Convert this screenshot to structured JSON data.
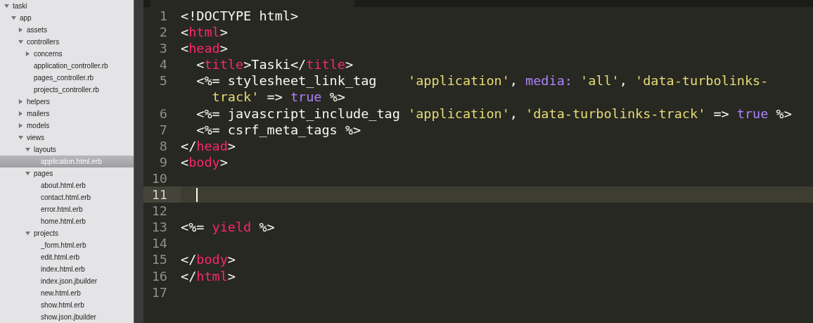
{
  "sidebar": {
    "tree": [
      {
        "label": "taski",
        "kind": "folder",
        "expanded": true,
        "selected": false,
        "children": [
          {
            "label": "app",
            "kind": "folder",
            "expanded": true,
            "selected": false,
            "children": [
              {
                "label": "assets",
                "kind": "folder",
                "expanded": false,
                "selected": false
              },
              {
                "label": "controllers",
                "kind": "folder",
                "expanded": true,
                "selected": false,
                "children": [
                  {
                    "label": "concerns",
                    "kind": "folder",
                    "expanded": false,
                    "selected": false
                  },
                  {
                    "label": "application_controller.rb",
                    "kind": "file",
                    "selected": false
                  },
                  {
                    "label": "pages_controller.rb",
                    "kind": "file",
                    "selected": false
                  },
                  {
                    "label": "projects_controller.rb",
                    "kind": "file",
                    "selected": false
                  }
                ]
              },
              {
                "label": "helpers",
                "kind": "folder",
                "expanded": false,
                "selected": false
              },
              {
                "label": "mailers",
                "kind": "folder",
                "expanded": false,
                "selected": false
              },
              {
                "label": "models",
                "kind": "folder",
                "expanded": false,
                "selected": false
              },
              {
                "label": "views",
                "kind": "folder",
                "expanded": true,
                "selected": false,
                "children": [
                  {
                    "label": "layouts",
                    "kind": "folder",
                    "expanded": true,
                    "selected": false,
                    "children": [
                      {
                        "label": "application.html.erb",
                        "kind": "file",
                        "selected": true
                      }
                    ]
                  },
                  {
                    "label": "pages",
                    "kind": "folder",
                    "expanded": true,
                    "selected": false,
                    "children": [
                      {
                        "label": "about.html.erb",
                        "kind": "file",
                        "selected": false
                      },
                      {
                        "label": "contact.html.erb",
                        "kind": "file",
                        "selected": false
                      },
                      {
                        "label": "error.html.erb",
                        "kind": "file",
                        "selected": false
                      },
                      {
                        "label": "home.html.erb",
                        "kind": "file",
                        "selected": false
                      }
                    ]
                  },
                  {
                    "label": "projects",
                    "kind": "folder",
                    "expanded": true,
                    "selected": false,
                    "children": [
                      {
                        "label": "_form.html.erb",
                        "kind": "file",
                        "selected": false
                      },
                      {
                        "label": "edit.html.erb",
                        "kind": "file",
                        "selected": false
                      },
                      {
                        "label": "index.html.erb",
                        "kind": "file",
                        "selected": false
                      },
                      {
                        "label": "index.json.jbuilder",
                        "kind": "file",
                        "selected": false
                      },
                      {
                        "label": "new.html.erb",
                        "kind": "file",
                        "selected": false
                      },
                      {
                        "label": "show.html.erb",
                        "kind": "file",
                        "selected": false
                      },
                      {
                        "label": "show.json.jbuilder",
                        "kind": "file",
                        "selected": false
                      }
                    ]
                  }
                ]
              }
            ]
          }
        ]
      }
    ]
  },
  "editor": {
    "lines": [
      {
        "number": "1",
        "current": false,
        "rows": [
          [
            {
              "kind": "plain",
              "text": "<!DOCTYPE html>"
            }
          ]
        ]
      },
      {
        "number": "2",
        "current": false,
        "rows": [
          [
            {
              "kind": "plain",
              "text": "<"
            },
            {
              "kind": "tag",
              "text": "html"
            },
            {
              "kind": "plain",
              "text": ">"
            }
          ]
        ]
      },
      {
        "number": "3",
        "current": false,
        "rows": [
          [
            {
              "kind": "plain",
              "text": "<"
            },
            {
              "kind": "tag",
              "text": "head"
            },
            {
              "kind": "plain",
              "text": ">"
            }
          ]
        ]
      },
      {
        "number": "4",
        "current": false,
        "rows": [
          [
            {
              "kind": "plain",
              "text": "  <"
            },
            {
              "kind": "tag",
              "text": "title"
            },
            {
              "kind": "plain",
              "text": ">Taski</"
            },
            {
              "kind": "tag",
              "text": "title"
            },
            {
              "kind": "plain",
              "text": ">"
            }
          ]
        ]
      },
      {
        "number": "5",
        "current": false,
        "rows": [
          [
            {
              "kind": "plain",
              "text": "  <%= stylesheet_link_tag    "
            },
            {
              "kind": "string",
              "text": "'application'"
            },
            {
              "kind": "plain",
              "text": ", "
            },
            {
              "kind": "keyword",
              "text": "media:"
            },
            {
              "kind": "plain",
              "text": " "
            },
            {
              "kind": "string",
              "text": "'all'"
            },
            {
              "kind": "plain",
              "text": ", "
            },
            {
              "kind": "string",
              "text": "'data-turbolinks-"
            },
            {
              "kind": "string",
              "text": "    track'",
              "wrapped": true
            },
            {
              "kind": "plain",
              "text": " => "
            },
            {
              "kind": "keyword",
              "text": "true"
            },
            {
              "kind": "plain",
              "text": " %>"
            }
          ]
        ]
      },
      {
        "number": "6",
        "current": false,
        "rows": [
          [
            {
              "kind": "plain",
              "text": "  <%= javascript_include_tag "
            },
            {
              "kind": "string",
              "text": "'application'"
            },
            {
              "kind": "plain",
              "text": ", "
            },
            {
              "kind": "string",
              "text": "'data-turbolinks-track'"
            },
            {
              "kind": "plain",
              "text": " => "
            },
            {
              "kind": "keyword",
              "text": "true"
            },
            {
              "kind": "plain",
              "text": " %>"
            }
          ]
        ]
      },
      {
        "number": "7",
        "current": false,
        "rows": [
          [
            {
              "kind": "plain",
              "text": "  <%= csrf_meta_tags %>"
            }
          ]
        ]
      },
      {
        "number": "8",
        "current": false,
        "rows": [
          [
            {
              "kind": "plain",
              "text": "</"
            },
            {
              "kind": "tag",
              "text": "head"
            },
            {
              "kind": "plain",
              "text": ">"
            }
          ]
        ]
      },
      {
        "number": "9",
        "current": false,
        "rows": [
          [
            {
              "kind": "plain",
              "text": "<"
            },
            {
              "kind": "tag",
              "text": "body"
            },
            {
              "kind": "plain",
              "text": ">"
            }
          ]
        ]
      },
      {
        "number": "10",
        "current": false,
        "rows": [
          []
        ]
      },
      {
        "number": "11",
        "current": true,
        "rows": [
          []
        ]
      },
      {
        "number": "12",
        "current": false,
        "rows": [
          []
        ]
      },
      {
        "number": "13",
        "current": false,
        "rows": [
          [
            {
              "kind": "plain",
              "text": "<%= "
            },
            {
              "kind": "tag",
              "text": "yield"
            },
            {
              "kind": "plain",
              "text": " %>"
            }
          ]
        ]
      },
      {
        "number": "14",
        "current": false,
        "rows": [
          []
        ]
      },
      {
        "number": "15",
        "current": false,
        "rows": [
          [
            {
              "kind": "plain",
              "text": "</"
            },
            {
              "kind": "tag",
              "text": "body"
            },
            {
              "kind": "plain",
              "text": ">"
            }
          ]
        ]
      },
      {
        "number": "16",
        "current": false,
        "rows": [
          [
            {
              "kind": "plain",
              "text": "</"
            },
            {
              "kind": "tag",
              "text": "html"
            },
            {
              "kind": "plain",
              "text": ">"
            }
          ]
        ]
      },
      {
        "number": "17",
        "current": false,
        "rows": [
          []
        ]
      }
    ]
  }
}
